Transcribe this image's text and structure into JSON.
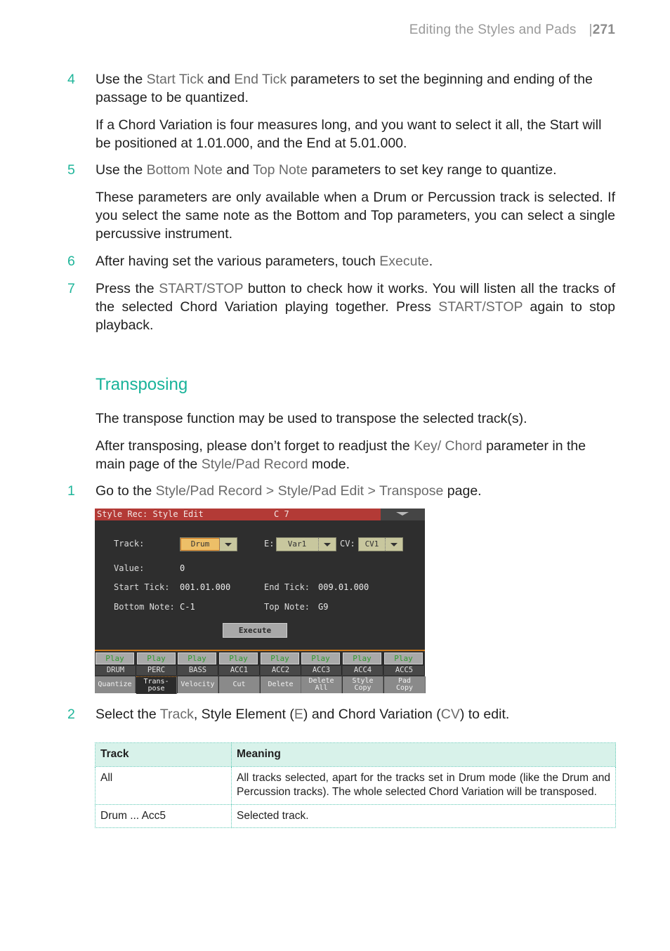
{
  "header": {
    "section": "Editing the Styles and Pads",
    "separator": "|",
    "page_number": "271"
  },
  "steps_a": [
    {
      "num": "4",
      "parts": [
        "Use the ",
        "Start Tick",
        " and ",
        "End Tick",
        " parameters to set the beginning and ending of the passage to be quantized."
      ],
      "note": "If a Chord Variation is four measures long, and you want to select it all, the Start will be positioned at 1.01.000, and the End at 5.01.000."
    },
    {
      "num": "5",
      "parts": [
        "Use the ",
        "Bottom Note",
        " and ",
        "Top Note",
        " parameters to set key range to quantize."
      ],
      "note": "These parameters are only available when a Drum or Percussion track is selected. If you select the same note as the Bottom and Top parameters, you can select a single percussive instrument."
    },
    {
      "num": "6",
      "parts": [
        "After having set the various parameters, touch ",
        "Execute",
        "."
      ]
    },
    {
      "num": "7",
      "parts": [
        "Press the ",
        "START/STOP",
        " button to check how it works. You will listen all the tracks of the selected Chord Variation playing together. Press ",
        "START/STOP",
        " again to stop playback."
      ]
    }
  ],
  "section_title": "Transposing",
  "intro": "The transpose function may be used to transpose the selected track(s).",
  "after_note": {
    "parts": [
      "After transposing, please don’t forget to readjust the ",
      "Key/ Chord",
      " parameter in the main page of the ",
      "Style/Pad Record",
      " mode."
    ]
  },
  "step1": {
    "num": "1",
    "parts": [
      "Go to the ",
      "Style/Pad Record > Style/Pad Edit > Transpose",
      " page."
    ]
  },
  "screen": {
    "title": "Style Rec: Style Edit",
    "chord": "C 7",
    "track_label": "Track:",
    "track_value": "Drum",
    "e_label": "E:",
    "e_value": "Var1",
    "cv_label": "CV:",
    "cv_value": "CV1",
    "value_label": "Value:",
    "value_value": "0",
    "start_tick_label": "Start Tick:",
    "start_tick_value": "001.01.000",
    "end_tick_label": "End Tick:",
    "end_tick_value": "009.01.000",
    "bottom_note_label": "Bottom Note:",
    "bottom_note_value": "C-1",
    "top_note_label": "Top Note:",
    "top_note_value": "G9",
    "execute_label": "Execute",
    "play_label": "Play",
    "tracks": [
      "DRUM",
      "PERC",
      "BASS",
      "ACC1",
      "ACC2",
      "ACC3",
      "ACC4",
      "ACC5"
    ],
    "tabs": [
      "Quantize",
      "Trans-\npose",
      "Velocity",
      "Cut",
      "Delete",
      "Delete\nAll",
      "Style\nCopy",
      "Pad\nCopy"
    ],
    "active_tab": 1
  },
  "step2": {
    "num": "2",
    "parts": [
      "Select the ",
      "Track",
      ", Style Element (",
      "E",
      ") and Chord Variation (",
      "CV",
      ") to edit."
    ]
  },
  "table": {
    "headers": [
      "Track",
      "Meaning"
    ],
    "rows": [
      [
        "All",
        "All tracks selected, apart for the tracks set in Drum mode (like the Drum and Percussion tracks). The whole selected Chord Variation will be transposed."
      ],
      [
        "Drum ... Acc5",
        "Selected track."
      ]
    ]
  },
  "colors": {
    "accent_teal": "#19b39a",
    "highlight_gray": "#6b6b6b",
    "screen_title_red": "#b33a36",
    "screen_selected_orange": "#edbf68",
    "table_header_bg": "#d8f2ea"
  }
}
